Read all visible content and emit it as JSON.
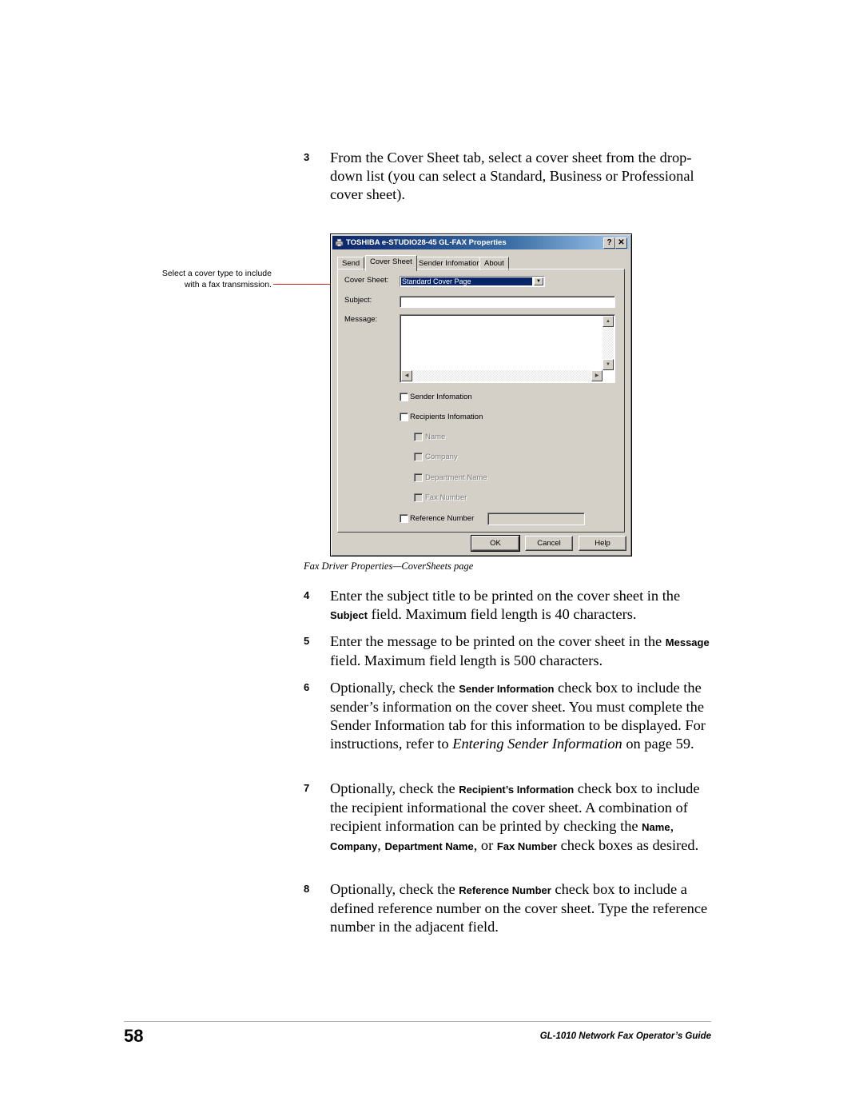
{
  "steps": [
    {
      "number": "3",
      "text": "From the Cover Sheet tab, select a cover sheet from the drop-down list (you can select a Standard, Business or Professional cover sheet)."
    },
    {
      "number": "4",
      "pre": "Enter the subject title to be printed on the cover sheet in the ",
      "ui": "Subject",
      "post": " field. Maximum field length is 40 characters."
    },
    {
      "number": "5",
      "pre": "Enter the message to be printed on the cover sheet in the ",
      "ui": "Message",
      "post": " field. Maximum field length is 500 characters."
    },
    {
      "number": "6",
      "pre": "Optionally, check the ",
      "ui": "Sender Information",
      "mid": " check box to include the sender’s information on the cover sheet. You must complete the Sender Information tab for this information to be displayed. For instructions, refer to ",
      "link": "Entering Sender Information",
      "post": " on page 59."
    },
    {
      "number": "7",
      "pre": "Optionally, check the ",
      "ui": "Recipient’s Information",
      "mid": " check box to include the recipient informational the cover sheet. A combination of recipient information can be printed by checking the ",
      "ui_items": [
        "Name",
        "Company",
        "Department Name",
        "Fax Number"
      ],
      "sep1": ", ",
      "sep2": ", ",
      "sep3": ", or ",
      "post": " check boxes as desired."
    },
    {
      "number": "8",
      "pre": "Optionally, check the ",
      "ui": "Reference Number",
      "post": " check box to include a defined reference number on the cover sheet. Type the reference number in the adjacent field."
    }
  ],
  "callout": {
    "line1": "Select a cover type to include",
    "line2": "with a fax transmission."
  },
  "dialog": {
    "title": "TOSHIBA e-STUDIO28-45 GL-FAX Properties",
    "help_button": "?",
    "close_button": "✕",
    "tabs": [
      {
        "label": "Send",
        "active": false
      },
      {
        "label": "Cover Sheet",
        "active": true
      },
      {
        "label": "Sender Infomation",
        "active": false
      },
      {
        "label": "About",
        "active": false
      }
    ],
    "cover_sheet_label": "Cover Sheet:",
    "cover_sheet_value": "Standard Cover Page",
    "subject_label": "Subject:",
    "subject_value": "",
    "message_label": "Message:",
    "message_value": "",
    "checkboxes": [
      {
        "label": "Sender Infomation",
        "checked": false,
        "enabled": true
      },
      {
        "label": "Recipients Infomation",
        "checked": false,
        "enabled": true
      },
      {
        "label": "Name",
        "checked": false,
        "enabled": false
      },
      {
        "label": "Company",
        "checked": false,
        "enabled": false
      },
      {
        "label": "Department Name",
        "checked": false,
        "enabled": false
      },
      {
        "label": "Fax Number",
        "checked": false,
        "enabled": false
      },
      {
        "label": "Reference Number",
        "checked": false,
        "enabled": true
      }
    ],
    "reference_number_value": "",
    "buttons": {
      "ok": "OK",
      "cancel": "Cancel",
      "help": "Help"
    }
  },
  "caption": "Fax Driver Properties—CoverSheets page",
  "footer": {
    "page_number": "58",
    "guide_title": "GL-1010 Network Fax Operator’s Guide"
  }
}
